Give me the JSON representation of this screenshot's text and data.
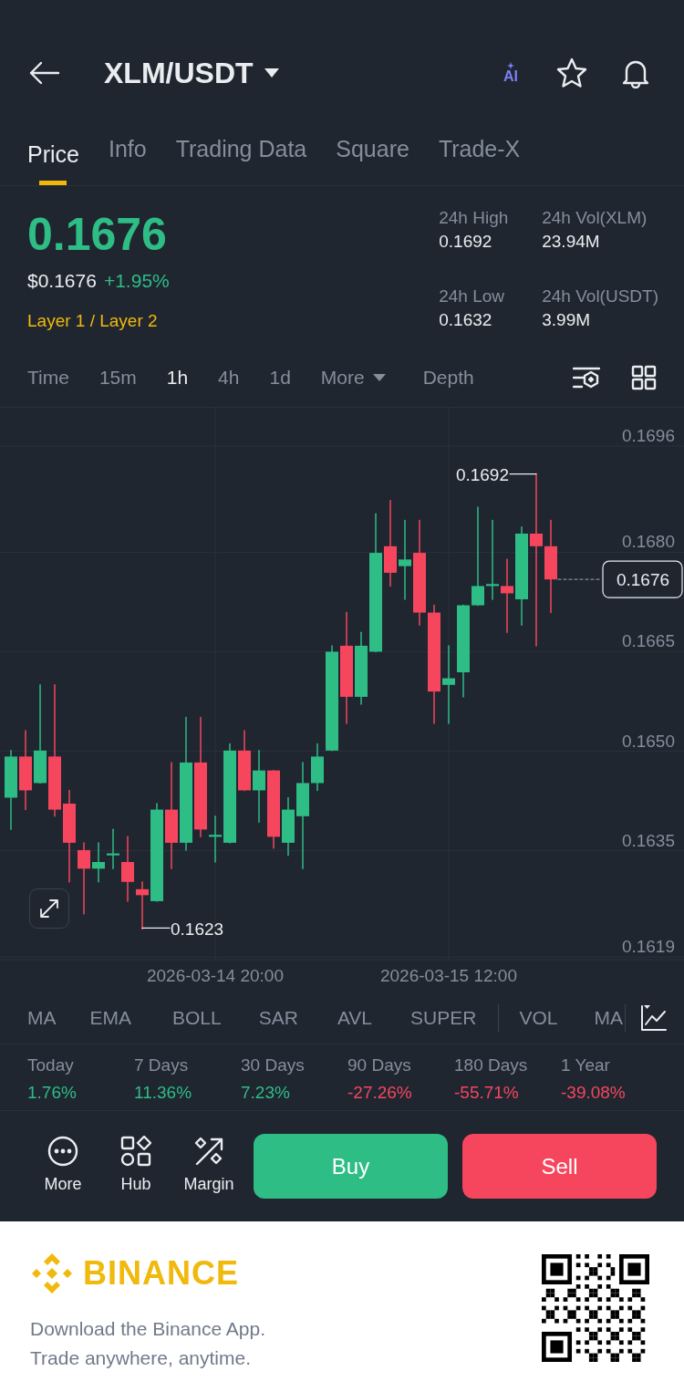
{
  "header": {
    "pair": "XLM/USDT",
    "ai_label": "AI"
  },
  "tabs": [
    {
      "label": "Price",
      "selected": true
    },
    {
      "label": "Info",
      "selected": false
    },
    {
      "label": "Trading Data",
      "selected": false
    },
    {
      "label": "Square",
      "selected": false
    },
    {
      "label": "Trade-X",
      "selected": false
    }
  ],
  "price": {
    "last": "0.1676",
    "usd": "$0.1676",
    "change": "+1.95%",
    "category": "Layer 1 / Layer 2"
  },
  "stats": [
    {
      "label": "24h High",
      "value": "0.1692"
    },
    {
      "label": "24h Vol(XLM)",
      "value": "23.94M"
    },
    {
      "label": "24h Low",
      "value": "0.1632"
    },
    {
      "label": "24h Vol(USDT)",
      "value": "3.99M"
    }
  ],
  "intervals": [
    {
      "label": "Time",
      "kind": "option",
      "selected": false
    },
    {
      "label": "15m",
      "kind": "option",
      "selected": false
    },
    {
      "label": "1h",
      "kind": "option",
      "selected": true
    },
    {
      "label": "4h",
      "kind": "option",
      "selected": false
    },
    {
      "label": "1d",
      "kind": "option",
      "selected": false
    },
    {
      "label": "More",
      "kind": "dropdown",
      "selected": false
    },
    {
      "label": "Depth",
      "kind": "option",
      "selected": false
    }
  ],
  "chart": {
    "chart_data": {
      "type": "candlestick",
      "categories": [
        null,
        null,
        null,
        null,
        null,
        null,
        null,
        null,
        null,
        null,
        null,
        null,
        null,
        null,
        "2026-03-14 20:00",
        null,
        null,
        null,
        null,
        null,
        null,
        null,
        null,
        null,
        null,
        null,
        null,
        null,
        null,
        null,
        "2026-03-15 12:00",
        null,
        null,
        null,
        null,
        null,
        null,
        null
      ],
      "ohlc": [
        [
          0.1643,
          0.16501,
          0.16382,
          0.16492
        ],
        [
          0.16492,
          0.16531,
          0.16412,
          0.16441
        ],
        [
          0.16452,
          0.166,
          0.16452,
          0.16501
        ],
        [
          0.16492,
          0.166,
          0.16402,
          0.16412
        ],
        [
          0.16421,
          0.16441,
          0.16303,
          0.16362
        ],
        [
          0.16351,
          0.16362,
          0.16255,
          0.16323
        ],
        [
          0.16323,
          0.16362,
          0.16303,
          0.16333
        ],
        [
          0.16343,
          0.16382,
          0.16323,
          0.16346
        ],
        [
          0.16333,
          0.16371,
          0.16274,
          0.16303
        ],
        [
          0.16292,
          0.16303,
          0.16232,
          0.16283
        ],
        [
          0.16274,
          0.16421,
          0.16274,
          0.16412
        ],
        [
          0.16412,
          0.16483,
          0.16323,
          0.16362
        ],
        [
          0.16362,
          0.16551,
          0.16351,
          0.16483
        ],
        [
          0.16483,
          0.16551,
          0.16371,
          0.16382
        ],
        [
          0.16371,
          0.16402,
          0.16333,
          0.16374
        ],
        [
          0.16362,
          0.16511,
          0.16362,
          0.16501
        ],
        [
          0.16501,
          0.16531,
          0.16441,
          0.16441
        ],
        [
          0.16441,
          0.16501,
          0.16393,
          0.16471
        ],
        [
          0.16471,
          0.16471,
          0.16354,
          0.16371
        ],
        [
          0.16362,
          0.1643,
          0.16343,
          0.16412
        ],
        [
          0.16402,
          0.16483,
          0.16323,
          0.16452
        ],
        [
          0.16452,
          0.16511,
          0.16441,
          0.16492
        ],
        [
          0.16501,
          0.16659,
          0.16501,
          0.1665
        ],
        [
          0.16659,
          0.16709,
          0.16542,
          0.16582
        ],
        [
          0.16582,
          0.16679,
          0.16571,
          0.16659
        ],
        [
          0.1665,
          0.16858,
          0.1665,
          0.16799
        ],
        [
          0.16809,
          0.16878,
          0.16749,
          0.16769
        ],
        [
          0.16779,
          0.16848,
          0.16729,
          0.16789
        ],
        [
          0.16799,
          0.16848,
          0.1669,
          0.16709
        ],
        [
          0.16709,
          0.1672,
          0.16542,
          0.1659
        ],
        [
          0.166,
          0.16659,
          0.16542,
          0.1661
        ],
        [
          0.16619,
          0.1672,
          0.16582,
          0.1672
        ],
        [
          0.1672,
          0.16868,
          0.1672,
          0.16749
        ],
        [
          0.16749,
          0.16848,
          0.16729,
          0.16752
        ],
        [
          0.16749,
          0.16789,
          0.16679,
          0.16738
        ],
        [
          0.16729,
          0.16838,
          0.1669,
          0.16828
        ],
        [
          0.16828,
          0.16918,
          0.16659,
          0.16809
        ],
        [
          0.16809,
          0.16848,
          0.16709,
          0.16759
        ]
      ],
      "ylim": [
        0.1619,
        0.1696
      ],
      "grid": true,
      "yticks": [
        {
          "value": 0.1696,
          "label": "0.1696"
        },
        {
          "value": 0.168,
          "label": "0.1680"
        },
        {
          "value": 0.1665,
          "label": "0.1665"
        },
        {
          "value": 0.165,
          "label": "0.1650"
        },
        {
          "value": 0.1635,
          "label": "0.1635"
        },
        {
          "value": 0.1619,
          "label": "0.1619"
        }
      ],
      "annotations": [
        "0.1692",
        "0.1623",
        "0.1676"
      ]
    }
  },
  "indicators": {
    "main": [
      "MA",
      "EMA",
      "BOLL",
      "SAR",
      "AVL",
      "SUPER"
    ],
    "sub": [
      "VOL",
      "MA"
    ]
  },
  "performance": [
    {
      "period": "Today",
      "change": "1.76%",
      "color": "#2ebd85"
    },
    {
      "period": "7 Days",
      "change": "11.36%",
      "color": "#2ebd85"
    },
    {
      "period": "30 Days",
      "change": "7.23%",
      "color": "#2ebd85"
    },
    {
      "period": "90 Days",
      "change": "-27.26%",
      "color": "#f6465d"
    },
    {
      "period": "180 Days",
      "change": "-55.71%",
      "color": "#f6465d"
    },
    {
      "period": "1 Year",
      "change": "-39.08%",
      "color": "#f6465d"
    }
  ],
  "actions": [
    {
      "label": "More",
      "kind": "more"
    },
    {
      "label": "Hub",
      "kind": "hub"
    },
    {
      "label": "Margin",
      "kind": "margin"
    }
  ],
  "trade_buttons": [
    {
      "label": "Buy",
      "kind": "buy"
    },
    {
      "label": "Sell",
      "kind": "sell"
    }
  ],
  "footer": {
    "brand": "BINANCE",
    "lines": [
      "Download the Binance App.",
      "Trade anywhere, anytime."
    ]
  }
}
